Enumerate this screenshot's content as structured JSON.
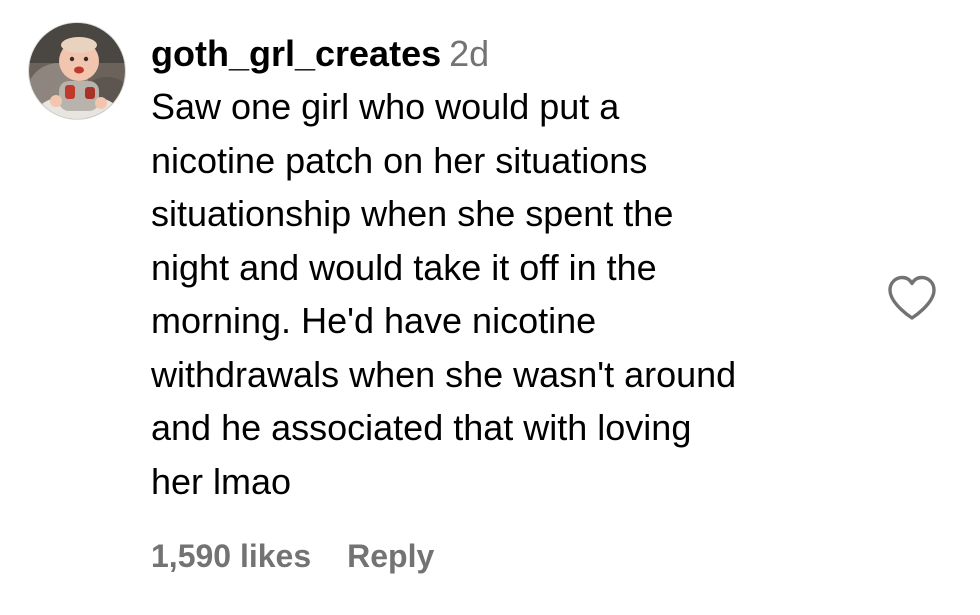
{
  "comment": {
    "username": "goth_grl_creates",
    "timestamp": "2d",
    "text_lines": [
      "Saw one girl who would put a",
      "nicotine patch on her situations",
      "situationship when she spent the",
      "night and would take it off in the",
      "morning. He'd have nicotine",
      "withdrawals when she wasn't around",
      "and he associated that with loving",
      "her lmao"
    ],
    "likes_label": "1,590 likes",
    "reply_label": "Reply",
    "like_icon": "heart-outline-icon"
  },
  "colors": {
    "text": "#000000",
    "secondary": "#737373",
    "background": "#ffffff"
  }
}
